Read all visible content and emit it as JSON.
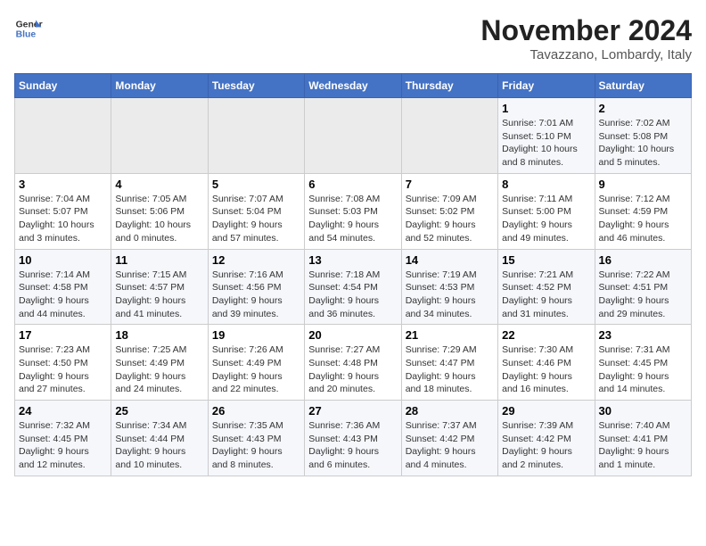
{
  "header": {
    "logo_line1": "General",
    "logo_line2": "Blue",
    "month": "November 2024",
    "location": "Tavazzano, Lombardy, Italy"
  },
  "days_of_week": [
    "Sunday",
    "Monday",
    "Tuesday",
    "Wednesday",
    "Thursday",
    "Friday",
    "Saturday"
  ],
  "weeks": [
    [
      {
        "day": "",
        "info": ""
      },
      {
        "day": "",
        "info": ""
      },
      {
        "day": "",
        "info": ""
      },
      {
        "day": "",
        "info": ""
      },
      {
        "day": "",
        "info": ""
      },
      {
        "day": "1",
        "info": "Sunrise: 7:01 AM\nSunset: 5:10 PM\nDaylight: 10 hours\nand 8 minutes."
      },
      {
        "day": "2",
        "info": "Sunrise: 7:02 AM\nSunset: 5:08 PM\nDaylight: 10 hours\nand 5 minutes."
      }
    ],
    [
      {
        "day": "3",
        "info": "Sunrise: 7:04 AM\nSunset: 5:07 PM\nDaylight: 10 hours\nand 3 minutes."
      },
      {
        "day": "4",
        "info": "Sunrise: 7:05 AM\nSunset: 5:06 PM\nDaylight: 10 hours\nand 0 minutes."
      },
      {
        "day": "5",
        "info": "Sunrise: 7:07 AM\nSunset: 5:04 PM\nDaylight: 9 hours\nand 57 minutes."
      },
      {
        "day": "6",
        "info": "Sunrise: 7:08 AM\nSunset: 5:03 PM\nDaylight: 9 hours\nand 54 minutes."
      },
      {
        "day": "7",
        "info": "Sunrise: 7:09 AM\nSunset: 5:02 PM\nDaylight: 9 hours\nand 52 minutes."
      },
      {
        "day": "8",
        "info": "Sunrise: 7:11 AM\nSunset: 5:00 PM\nDaylight: 9 hours\nand 49 minutes."
      },
      {
        "day": "9",
        "info": "Sunrise: 7:12 AM\nSunset: 4:59 PM\nDaylight: 9 hours\nand 46 minutes."
      }
    ],
    [
      {
        "day": "10",
        "info": "Sunrise: 7:14 AM\nSunset: 4:58 PM\nDaylight: 9 hours\nand 44 minutes."
      },
      {
        "day": "11",
        "info": "Sunrise: 7:15 AM\nSunset: 4:57 PM\nDaylight: 9 hours\nand 41 minutes."
      },
      {
        "day": "12",
        "info": "Sunrise: 7:16 AM\nSunset: 4:56 PM\nDaylight: 9 hours\nand 39 minutes."
      },
      {
        "day": "13",
        "info": "Sunrise: 7:18 AM\nSunset: 4:54 PM\nDaylight: 9 hours\nand 36 minutes."
      },
      {
        "day": "14",
        "info": "Sunrise: 7:19 AM\nSunset: 4:53 PM\nDaylight: 9 hours\nand 34 minutes."
      },
      {
        "day": "15",
        "info": "Sunrise: 7:21 AM\nSunset: 4:52 PM\nDaylight: 9 hours\nand 31 minutes."
      },
      {
        "day": "16",
        "info": "Sunrise: 7:22 AM\nSunset: 4:51 PM\nDaylight: 9 hours\nand 29 minutes."
      }
    ],
    [
      {
        "day": "17",
        "info": "Sunrise: 7:23 AM\nSunset: 4:50 PM\nDaylight: 9 hours\nand 27 minutes."
      },
      {
        "day": "18",
        "info": "Sunrise: 7:25 AM\nSunset: 4:49 PM\nDaylight: 9 hours\nand 24 minutes."
      },
      {
        "day": "19",
        "info": "Sunrise: 7:26 AM\nSunset: 4:49 PM\nDaylight: 9 hours\nand 22 minutes."
      },
      {
        "day": "20",
        "info": "Sunrise: 7:27 AM\nSunset: 4:48 PM\nDaylight: 9 hours\nand 20 minutes."
      },
      {
        "day": "21",
        "info": "Sunrise: 7:29 AM\nSunset: 4:47 PM\nDaylight: 9 hours\nand 18 minutes."
      },
      {
        "day": "22",
        "info": "Sunrise: 7:30 AM\nSunset: 4:46 PM\nDaylight: 9 hours\nand 16 minutes."
      },
      {
        "day": "23",
        "info": "Sunrise: 7:31 AM\nSunset: 4:45 PM\nDaylight: 9 hours\nand 14 minutes."
      }
    ],
    [
      {
        "day": "24",
        "info": "Sunrise: 7:32 AM\nSunset: 4:45 PM\nDaylight: 9 hours\nand 12 minutes."
      },
      {
        "day": "25",
        "info": "Sunrise: 7:34 AM\nSunset: 4:44 PM\nDaylight: 9 hours\nand 10 minutes."
      },
      {
        "day": "26",
        "info": "Sunrise: 7:35 AM\nSunset: 4:43 PM\nDaylight: 9 hours\nand 8 minutes."
      },
      {
        "day": "27",
        "info": "Sunrise: 7:36 AM\nSunset: 4:43 PM\nDaylight: 9 hours\nand 6 minutes."
      },
      {
        "day": "28",
        "info": "Sunrise: 7:37 AM\nSunset: 4:42 PM\nDaylight: 9 hours\nand 4 minutes."
      },
      {
        "day": "29",
        "info": "Sunrise: 7:39 AM\nSunset: 4:42 PM\nDaylight: 9 hours\nand 2 minutes."
      },
      {
        "day": "30",
        "info": "Sunrise: 7:40 AM\nSunset: 4:41 PM\nDaylight: 9 hours\nand 1 minute."
      }
    ]
  ]
}
